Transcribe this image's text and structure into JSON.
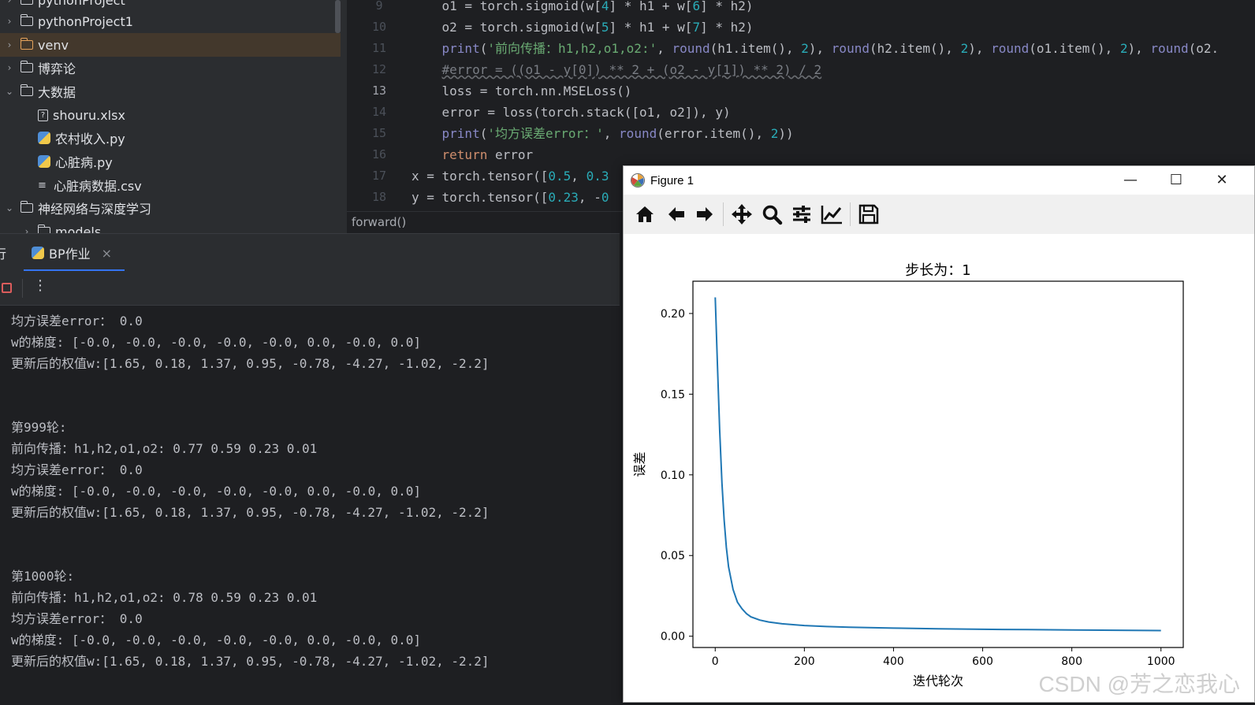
{
  "project_tree": {
    "items": [
      {
        "label": "pythonProject",
        "kind": "folder",
        "expanded": false
      },
      {
        "label": "pythonProject1",
        "kind": "folder",
        "expanded": false
      },
      {
        "label": "venv",
        "kind": "folder-excluded",
        "expanded": false,
        "selected": true
      },
      {
        "label": "博弈论",
        "kind": "folder",
        "expanded": false
      },
      {
        "label": "大数据",
        "kind": "folder",
        "expanded": true
      },
      {
        "label": "shouru.xlsx",
        "kind": "unknown-file"
      },
      {
        "label": "农村收入.py",
        "kind": "python-file"
      },
      {
        "label": "心脏病.py",
        "kind": "python-file"
      },
      {
        "label": "心脏病数据.csv",
        "kind": "text-file"
      },
      {
        "label": "神经网络与深度学习",
        "kind": "folder",
        "expanded": true
      },
      {
        "label": "models",
        "kind": "folder",
        "expanded": false
      }
    ]
  },
  "editor": {
    "current_line": "13",
    "lines": [
      {
        "no": "9",
        "text": "    o1 = torch.sigmoid(w[4] * h1 + w[6] * h2)"
      },
      {
        "no": "10",
        "text": "    o2 = torch.sigmoid(w[5] * h1 + w[7] * h2)"
      },
      {
        "no": "11",
        "text": "    print('前向传播：h1,h2,o1,o2:', round(h1.item(), 2), round(h2.item(), 2), round(o1.item(), 2), round(o2."
      },
      {
        "no": "12",
        "text": "    #error = ((o1 - y[0]) ** 2 + (o2 - y[1]) ** 2) / 2"
      },
      {
        "no": "13",
        "text": "    loss = torch.nn.MSELoss()"
      },
      {
        "no": "14",
        "text": "    error = loss(torch.stack([o1, o2]), y)"
      },
      {
        "no": "15",
        "text": "    print('均方误差error：', round(error.item(), 2))"
      },
      {
        "no": "16",
        "text": "    return error"
      },
      {
        "no": "17",
        "text": "x = torch.tensor([0.5, 0.3"
      },
      {
        "no": "18",
        "text": "y = torch.tensor([0.23, -0"
      }
    ],
    "breadcrumb": "forward()"
  },
  "run_panel": {
    "left_tab_fragment": "行",
    "tab_label": "BP作业",
    "console_lines": [
      "均方误差error： 0.0",
      "w的梯度: [-0.0, -0.0, -0.0, -0.0, -0.0, 0.0, -0.0, 0.0]",
      "更新后的权值w:[1.65, 0.18, 1.37, 0.95, -0.78, -4.27, -1.02, -2.2]",
      "",
      "",
      "第999轮:",
      "前向传播：h1,h2,o1,o2: 0.77 0.59 0.23 0.01",
      "均方误差error： 0.0",
      "w的梯度: [-0.0, -0.0, -0.0, -0.0, -0.0, 0.0, -0.0, 0.0]",
      "更新后的权值w:[1.65, 0.18, 1.37, 0.95, -0.78, -4.27, -1.02, -2.2]",
      "",
      "",
      "第1000轮:",
      "前向传播：h1,h2,o1,o2: 0.78 0.59 0.23 0.01",
      "均方误差error： 0.0",
      "w的梯度: [-0.0, -0.0, -0.0, -0.0, -0.0, 0.0, -0.0, 0.0]",
      "更新后的权值w:[1.65, 0.18, 1.37, 0.95, -0.78, -4.27, -1.02, -2.2]"
    ]
  },
  "figure_window": {
    "title": "Figure 1",
    "toolbar_icons": [
      "home-icon",
      "back-icon",
      "forward-icon",
      "pan-icon",
      "zoom-icon",
      "configure-subplots-icon",
      "edit-axis-icon",
      "save-icon"
    ],
    "watermark": "CSDN @芳之恋我心"
  },
  "chart_data": {
    "type": "line",
    "title": "步长为：1",
    "xlabel": "迭代轮次",
    "ylabel": "误差",
    "xlim": [
      -50,
      1050
    ],
    "ylim": [
      -0.007,
      0.22
    ],
    "xticks": [
      0,
      200,
      400,
      600,
      800,
      1000
    ],
    "yticks": [
      0.0,
      0.05,
      0.1,
      0.15,
      0.2
    ],
    "ytick_labels": [
      "0.00",
      "0.05",
      "0.10",
      "0.15",
      "0.20"
    ],
    "line_color": "#1f77b4",
    "grid": false,
    "series": [
      {
        "x": [
          0,
          5,
          10,
          15,
          20,
          25,
          30,
          40,
          50,
          60,
          70,
          80,
          100,
          120,
          150,
          200,
          250,
          300,
          400,
          500,
          600,
          700,
          800,
          900,
          1000
        ],
        "y": [
          0.21,
          0.168,
          0.128,
          0.095,
          0.072,
          0.055,
          0.043,
          0.029,
          0.021,
          0.017,
          0.014,
          0.012,
          0.01,
          0.0088,
          0.0077,
          0.0066,
          0.006,
          0.0056,
          0.005,
          0.0046,
          0.0043,
          0.0041,
          0.0039,
          0.0037,
          0.0035
        ]
      }
    ]
  }
}
